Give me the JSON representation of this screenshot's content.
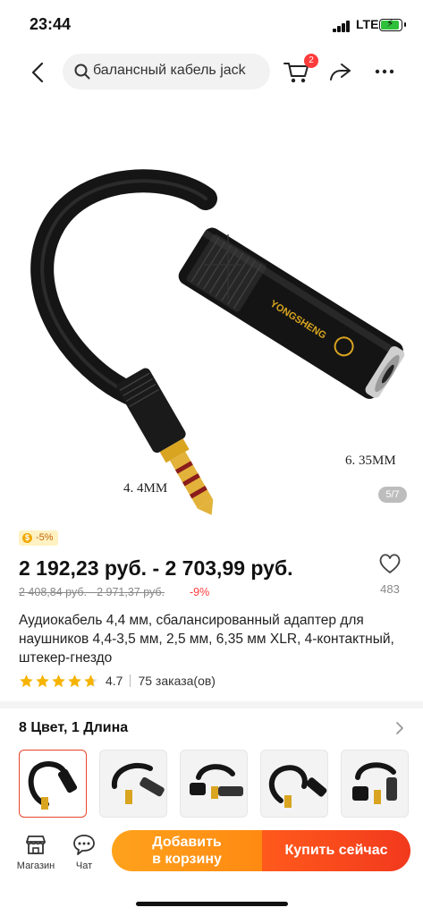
{
  "status_bar": {
    "time": "23:44",
    "network": "LTE"
  },
  "nav": {
    "search_text": "балансный кабель jack",
    "cart_badge": "2",
    "icons": [
      "back-arrow-icon",
      "search-icon",
      "cart-icon",
      "share-icon",
      "more-icon"
    ]
  },
  "gallery": {
    "counter": "5/7",
    "label_left": "4. 4MM",
    "label_right": "6. 35MM",
    "brand_text": "YONGSHENG"
  },
  "product": {
    "discount_badge": "-5%",
    "price": "2 192,23 руб. - 2 703,99 руб.",
    "old_price": "2 408,84 руб. - 2 971,37 руб.",
    "old_discount": "-9%",
    "favorites": "483",
    "title": "Аудиокабель 4,4 мм, сбалансированный адаптер для наушников 4,4-3,5 мм, 2,5 мм, 6,35 мм XLR, 4-контактный, штекер-гнездо",
    "rating": "4.7",
    "rating_value": 4.7,
    "orders": "75 заказа(ов)"
  },
  "variants": {
    "label": "8 Цвет, 1 Длина",
    "thumbnail_count_visible": 5,
    "selected_index": 0
  },
  "bottom_bar": {
    "store_label": "Магазин",
    "chat_label": "Чат",
    "add_to_cart_label": "Добавить в корзину",
    "buy_now_label": "Купить сейчас"
  },
  "colors": {
    "accent_red": "#ff3b3b",
    "cart_orange": "#ff9a18",
    "buy_red": "#f2391d",
    "star_gold": "#f6b300",
    "battery_green": "#2fbf3b"
  }
}
